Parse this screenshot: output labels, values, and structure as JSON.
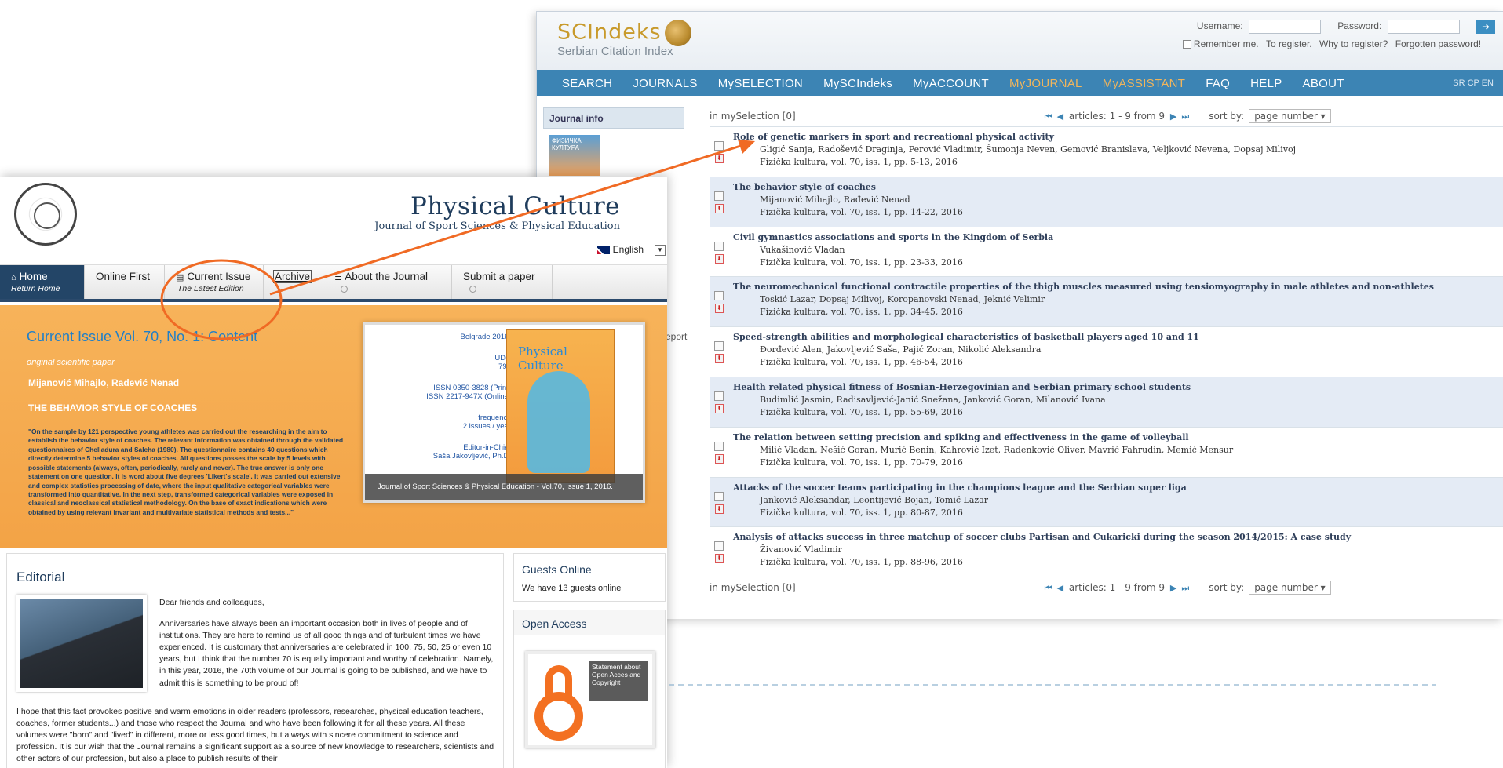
{
  "sci": {
    "brand": "SCIndeks",
    "tagline": "Serbian Citation Index",
    "login": {
      "username_label": "Username:",
      "password_label": "Password:",
      "submit_icon": "arrow-right-icon",
      "remember": "Remember me.",
      "register": "To register.",
      "why_register": "Why to register?",
      "forgotten": "Forgotten password!"
    },
    "nav": [
      "SEARCH",
      "JOURNALS",
      "MySELECTION",
      "MySCIndeks",
      "MyACCOUNT",
      "MyJOURNAL",
      "MyASSISTANT",
      "FAQ",
      "HELP",
      "ABOUT"
    ],
    "nav_highlight_color": "#f0b55c",
    "lang": "SR  CP  EN",
    "side_header": "Journal info",
    "side_thumb_text": "ФИЗИЧКА КУЛТУРА",
    "report": "eport",
    "selection": "in mySelection [0]",
    "pager": "articles: 1 - 9 from 9",
    "sort_label": "sort by:",
    "sort_value": "page number",
    "articles": [
      {
        "title": "Role of genetic markers in sport and recreational physical activity",
        "authors": "Gligić Sanja, Radošević Draginja, Perović Vladimir, Šumonja Neven, Gemović Branislava, Veljković Nevena, Dopsaj Milivoj",
        "source": "Fizička kultura, vol. 70, iss. 1, pp. 5-13, 2016"
      },
      {
        "title": "The behavior style of coaches",
        "authors": "Mijanović Mihajlo, Rađević Nenad",
        "source": "Fizička kultura, vol. 70, iss. 1, pp. 14-22, 2016"
      },
      {
        "title": "Civil gymnastics associations and sports in the Kingdom of Serbia",
        "authors": "Vukašinović Vladan",
        "source": "Fizička kultura, vol. 70, iss. 1, pp. 23-33, 2016"
      },
      {
        "title": "The neuromechanical functional contractile properties of the thigh muscles measured using tensiomyography in male athletes and non-athletes",
        "authors": "Toskić Lazar, Dopsaj Milivoj, Koropanovski Nenad, Jeknić Velimir",
        "source": "Fizička kultura, vol. 70, iss. 1, pp. 34-45, 2016"
      },
      {
        "title": "Speed-strength abilities and morphological characteristics of basketball players aged 10 and 11",
        "authors": "Đorđević Alen, Jakovljević Saša, Pajić Zoran, Nikolić Aleksandra",
        "source": "Fizička kultura, vol. 70, iss. 1, pp. 46-54, 2016"
      },
      {
        "title": "Health related physical fitness of Bosnian-Herzegovinian and Serbian primary school students",
        "authors": "Budimlić Jasmin, Radisavljević-Janić Snežana, Janković Goran, Milanović Ivana",
        "source": "Fizička kultura, vol. 70, iss. 1, pp. 55-69, 2016"
      },
      {
        "title": "The relation between setting precision and spiking and effectiveness in the game of volleyball",
        "authors": "Milić Vladan, Nešić Goran, Murić Benin, Kahrović Izet, Radenković Oliver, Mavrić Fahrudin, Memić Mensur",
        "source": "Fizička kultura, vol. 70, iss. 1, pp. 70-79, 2016"
      },
      {
        "title": "Attacks of the soccer teams participating in the champions league and the Serbian super liga",
        "authors": "Janković Aleksandar, Leontijević Bojan, Tomić Lazar",
        "source": "Fizička kultura, vol. 70, iss. 1, pp. 80-87, 2016"
      },
      {
        "title": "Analysis of attacks success in three matchup of soccer clubs Partisan and Cukaricki during the season 2014/2015: A case study",
        "authors": "Živanović Vladimir",
        "source": "Fizička kultura, vol. 70, iss. 1, pp. 88-96, 2016"
      }
    ]
  },
  "pc": {
    "title": "Physical Culture",
    "subtitle": "Journal of Sport Sciences & Physical Education",
    "language": "English",
    "menu": [
      {
        "label": "Home",
        "sub": "Return Home",
        "icon": "home-icon"
      },
      {
        "label": "Online First",
        "sub": ""
      },
      {
        "label": "Current Issue",
        "sub": "The Latest Edition",
        "icon": "document-icon"
      },
      {
        "label": "Archive",
        "sub": ""
      },
      {
        "label": "About the Journal",
        "sub": "",
        "icon": "list-icon"
      },
      {
        "label": "Submit a paper",
        "sub": ""
      }
    ],
    "banner": {
      "heading": "Current Issue Vol. 70, No. 1: Content",
      "tag": "original scientific paper",
      "authors": "Mijanović Mihajlo, Rađević Nenad",
      "article": "THE BEHAVIOR STYLE OF COACHES",
      "abstract": "\"On the sample by 121 perspective young athletes was carried out the researching in the aim to establish the behavior style of coaches. The relevant information was obtained through the validated questionnaires of Chelladura and Saleha (1980). The questionnaire contains 40 questions which directly determine 5 behavior styles of coaches. All questions posses the scale by 5 levels with possible statements (always, often, periodically, rarely and never). The true answer is only one statement on one question. It is word about five degrees 'Likert's scale'. It was carried out extensive and complex statistics processing of date, where the input qualitative categorical variables were transformed into quantitative. In the next step, transformed categorical variables were exposed in classical and neoclassical statistical methodology. On the base of exact indications which were obtained by using relevant invariant and multivariate statistical methods and tests...\"",
      "card": {
        "place": "Belgrade 2016.",
        "udc_label": "UDC",
        "udc": "796",
        "issn_print": "ISSN 0350-3828 (Print)",
        "issn_online": "ISSN 2217-947X (Online)",
        "freq_label": "frequency",
        "freq": "2 issues / year",
        "editor_label": "Editor-in-Chief",
        "editor": "Saša Jakovljević, Ph.D.",
        "cover_title": "Physical Culture",
        "caption": "Journal of Sport Sciences & Physical Education - Vol.70, Issue 1, 2016."
      }
    },
    "editorial": {
      "heading": "Editorial",
      "greeting": "Dear friends and colleagues,",
      "p1": "Anniversaries have always been an important occasion both in lives of people and of institutions. They are here to remind us of all good things and of turbulent times we have experienced. It is customary that anniversaries are celebrated in 100, 75, 50, 25 or even 10 years, but I think that the number 70 is equally important and worthy of celebration. Namely, in this year, 2016, the 70th volume of our Journal is going to be published, and we have to admit this is something to be proud of!",
      "p2": "I hope that this fact provokes positive and warm emotions in older readers (professors, researches, physical education teachers, coaches, former students...) and those who respect the Journal and who have been following it for all these years. All these volumes were \"born\" and \"lived\" in different, more or less good times, but always with sincere commitment to science and profession. It is our wish that the Journal remains a significant support as a source of new knowledge to researchers, scientists and other actors of our profession, but also a place to publish results of their"
    },
    "guests": {
      "heading": "Guests Online",
      "text": "We have 13 guests online"
    },
    "open_access": {
      "heading": "Open Access",
      "statement": "Statement about Open Acces and Copyright"
    }
  },
  "overlay": {
    "accent": "#f06a24"
  }
}
